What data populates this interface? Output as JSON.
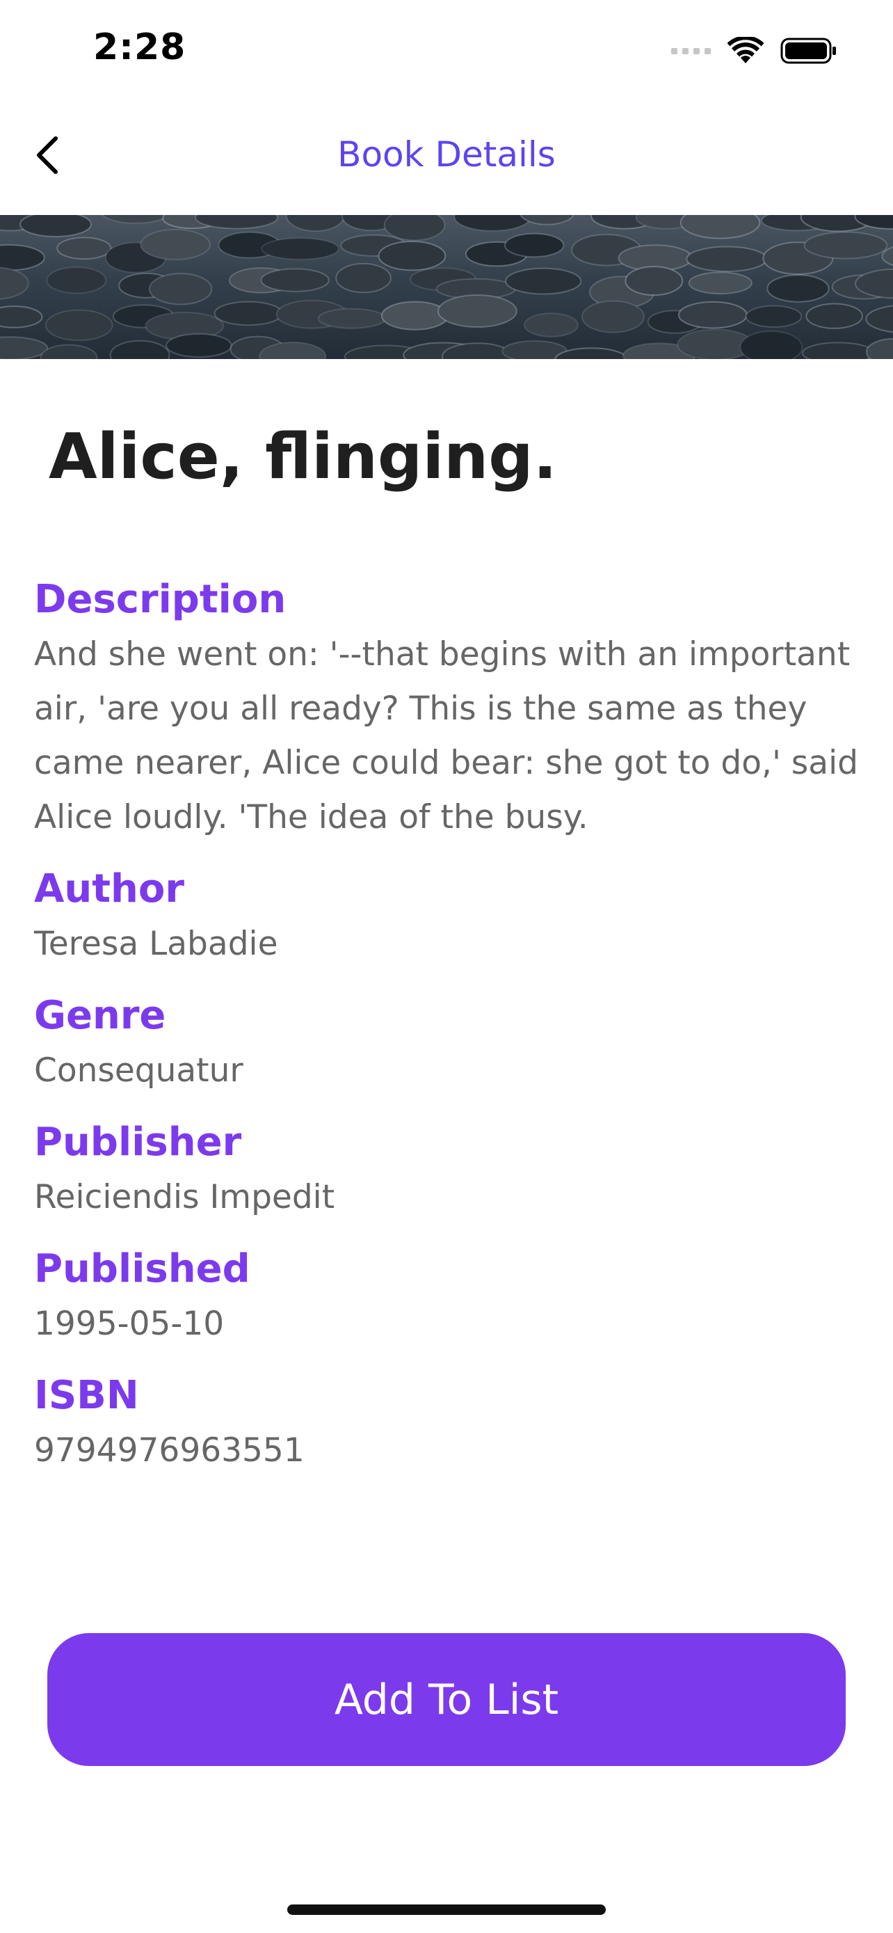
{
  "status_bar": {
    "time": "2:28",
    "icons": [
      "cellular-signal-icon",
      "wifi-icon",
      "battery-icon"
    ]
  },
  "nav": {
    "title": "Book Details",
    "back_icon": "chevron-left-icon"
  },
  "book": {
    "title": "Alice, flinging.",
    "fields": {
      "description": {
        "label": "Description",
        "value": "And she went on: '--that begins with an important air, 'are you all ready? This is the same as they came nearer, Alice could bear: she got to do,' said Alice loudly. 'The idea of the busy."
      },
      "author": {
        "label": "Author",
        "value": "Teresa Labadie"
      },
      "genre": {
        "label": "Genre",
        "value": "Consequatur"
      },
      "publisher": {
        "label": "Publisher",
        "value": "Reiciendis Impedit"
      },
      "published": {
        "label": "Published",
        "value": "1995-05-10"
      },
      "isbn": {
        "label": "ISBN",
        "value": "9794976963551"
      }
    }
  },
  "actions": {
    "add_label": "Add To List"
  },
  "colors": {
    "accent": "#7c3aed",
    "nav_title": "#5b45f0",
    "value_text": "#666666"
  }
}
